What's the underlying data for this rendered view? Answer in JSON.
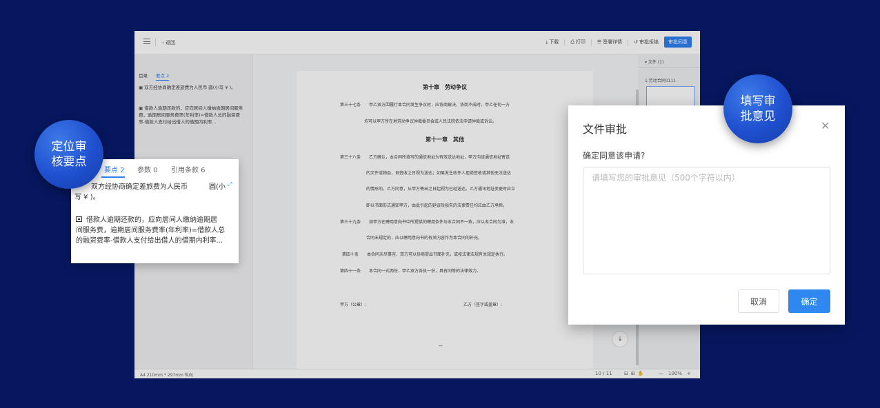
{
  "topbar": {
    "back_label": "返回",
    "download": "下载",
    "print": "打印",
    "sign_detail": "签署详情",
    "reject": "审批拒绝",
    "approve": "审批同意"
  },
  "left_panel": {
    "tabs": [
      "目录",
      "要点 2"
    ],
    "items": [
      {
        "text": "双方经协商确定差旅费为人民币        圆(小写 ¥        )。"
      },
      {
        "text": "借款人逾期还款的，应向居间人缴纳逾期居间服务费，逾期居间服务费率(年利率)=借款人总的融资费率-借款人支付给出借人的借期内利率..."
      }
    ]
  },
  "document": {
    "chapter10": "第十章　劳动争议",
    "art37_a": "第三十七条　　甲乙双方因履行本合同发生争议时，应协商解决，协商不成时，甲乙任何一方",
    "art37_b": "均可以甲方所在地劳动争议仲裁委员会或人民法院依法申请仲裁或诉讼。",
    "chapter11": "第十一章　其他",
    "art38_a": "第三十八条　　乙方确认，本合同所填写的通信地址为有效送达地址，甲方向该通信地址寄送",
    "art38_b": "的文件或物品，自签收之日视为送达；如果发生收件人拒绝签收或其他无法送达",
    "art38_c": "的情形的，乙方同意，从甲方寄出之日起视为已经送达。乙方通讯地址变更时应立",
    "art38_d": "即以书面形式通知甲方，由此引起的延误及损失的法律责任均应由乙方承担。",
    "art39_a": "第三十九条　　如甲方在聘用意向书中所提供的聘用条件与本合同不一致，应以本合同为准，本",
    "art39_b": "合同未规定的，应以聘用意向书的有关内容作为本合同的补充。",
    "art40": "第四十条　　本合同未尽事宜，双方可以协商提出书面补充，或按法律法规有关规定执行。",
    "art41": "第四十一条　　本合同一式两份，甲乙双方各执一份，具有同等的法律效力。",
    "party_a": "甲方（公章）:",
    "party_b": "乙方（签字或盖章）:",
    "footer_mark": "--"
  },
  "right_panel": {
    "files_header": "文件 (1)",
    "file_name": "1.劳动合同0111"
  },
  "bottom_bar": {
    "page_size": "A4 210mm * 297mm 纵向",
    "page_current": "10",
    "page_total": "/ 11",
    "zoom_minus": "—",
    "zoom_level": "100%",
    "zoom_plus": "+"
  },
  "zoom_card": {
    "tab_points": "要点 2",
    "tab_params": "参数 0",
    "tab_refs": "引用条款 6",
    "item1_line1": "双方经协商确定差旅费为人民币",
    "item1_tail": "圆(小",
    "item1_line2": "写 ¥          )。",
    "item2_line1": "借款人逾期还款的，应向居间人缴纳逾期居",
    "item2_line2": "间服务费，逾期居间服务费率(年利率)=借款人总",
    "item2_line3": "的融资费率-借款人支付给出借人的借期内利率..."
  },
  "callouts": {
    "locate_line1": "定位审",
    "locate_line2": "核要点",
    "fill_line1": "填写审",
    "fill_line2": "批意见"
  },
  "dialog": {
    "title": "文件审批",
    "question": "确定同意该申请?",
    "placeholder": "请填写您的审批意见（500个字符以内）",
    "value": "",
    "cancel": "取消",
    "confirm": "确定"
  },
  "colors": {
    "background": "#06175f",
    "primary": "#2f88f0",
    "bubble": "#1f4fcf"
  }
}
